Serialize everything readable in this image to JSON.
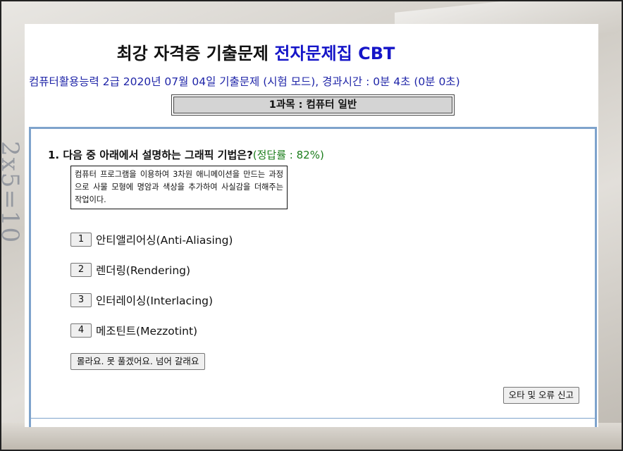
{
  "header": {
    "title_main": "최강 자격증 기출문제 ",
    "title_accent": "전자문제집 CBT"
  },
  "exam_info": "컴퓨터활용능력 2급 2020년 07월 04일 기출문제 (시험 모드), 경과시간 : 0분 4초 (0분 0초)",
  "subject": "1과목 : 컴퓨터 일반",
  "question": {
    "text": "1. 다음 중 아래에서 설명하는 그래픽 기법은?",
    "rate": "(정답률 : 82%)",
    "passage": "컴퓨터 프로그램을 이용하여 3차원 애니메이션을 만드는 과정으로 사물 모형에 명암과 색상을 추가하여 사실감을 더해주는 작업이다.",
    "choices": [
      {
        "num": "1",
        "label": "안티앨리어싱(Anti-Aliasing)"
      },
      {
        "num": "2",
        "label": "렌더링(Rendering)"
      },
      {
        "num": "3",
        "label": "인터레이싱(Interlacing)"
      },
      {
        "num": "4",
        "label": "메조틴트(Mezzotint)"
      }
    ]
  },
  "buttons": {
    "giveup": "몰라요. 못 풀겠어요. 넘어 갈래요",
    "report": "오타 및 오류 신고"
  },
  "backdrop_handwriting": "2x5=10",
  "colors": {
    "accent": "#1515c8",
    "info_text": "#1f25a8",
    "rate_text": "#1b7d1b",
    "panel_border": "#7ea3cc"
  }
}
